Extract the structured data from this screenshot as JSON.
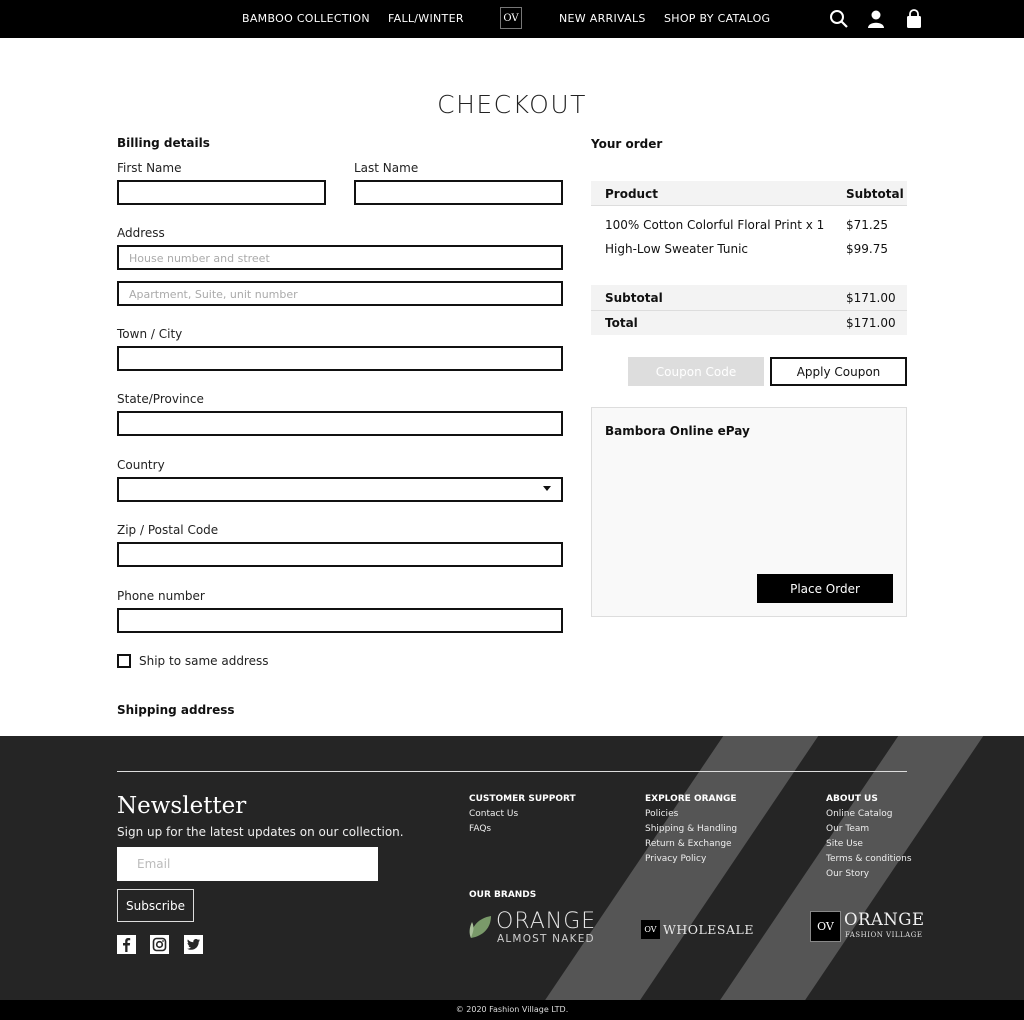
{
  "nav": {
    "items": [
      "BAMBOO COLLECTION",
      "FALL/WINTER",
      "NEW ARRIVALS",
      "SHOP BY CATALOG"
    ],
    "logo_text": "OV",
    "icons": [
      "search-icon",
      "account-icon",
      "cart-icon"
    ]
  },
  "page_title": "CHECKOUT",
  "billing": {
    "heading": "Billing details",
    "first_name_label": "First Name",
    "last_name_label": "Last Name",
    "address_label": "Address",
    "address_placeholder_1": "House number and street",
    "address_placeholder_2": "Apartment, Suite, unit number",
    "city_label": "Town / City",
    "state_label": "State/Province",
    "country_label": "Country",
    "zip_label": "Zip / Postal Code",
    "phone_label": "Phone number",
    "ship_same_label": "Ship to same address",
    "shipping_heading": "Shipping address"
  },
  "order": {
    "heading": "Your order",
    "col_product": "Product",
    "col_subtotal": "Subtotal",
    "items": [
      {
        "name": "100% Cotton Colorful Floral Print x 1",
        "price": "$71.25"
      },
      {
        "name": "High-Low Sweater Tunic",
        "price": "$99.75"
      }
    ],
    "subtotal_label": "Subtotal",
    "subtotal_value": "$171.00",
    "total_label": "Total",
    "total_value": "$171.00",
    "coupon_placeholder": "Coupon Code",
    "apply_coupon": "Apply Coupon",
    "payment_title": "Bambora Online ePay",
    "place_order": "Place Order"
  },
  "footer": {
    "newsletter_title": "Newsletter",
    "newsletter_sub": "Sign up for the latest updates on our collection.",
    "email_placeholder": "Email",
    "subscribe": "Subscribe",
    "social": [
      "facebook-icon",
      "instagram-icon",
      "twitter-icon"
    ],
    "customer_support": {
      "heading": "CUSTOMER SUPPORT",
      "links": [
        "Contact Us",
        "FAQs"
      ]
    },
    "explore": {
      "heading": "EXPLORE ORANGE",
      "links": [
        "Policies",
        "Shipping & Handling",
        "Return & Exchange",
        "Privacy Policy"
      ]
    },
    "about": {
      "heading": "ABOUT US",
      "links": [
        "Online Catalog",
        "Our Team",
        "Site Use",
        "Terms & conditions",
        "Our Story"
      ]
    },
    "brands_heading": "OUR  BRANDS",
    "brands": [
      {
        "line1": "ORANGE",
        "line2": "ALMOST NAKED"
      },
      {
        "line1": "WHOLESALE"
      },
      {
        "line1": "ORANGE",
        "line2": "FASHION VILLAGE"
      }
    ],
    "copyright": "© 2020 Fashion Village LTD."
  },
  "colors": {
    "nav_bg": "#000000",
    "footer_bg": "#252525",
    "accent_green": "#7a9a6a"
  }
}
